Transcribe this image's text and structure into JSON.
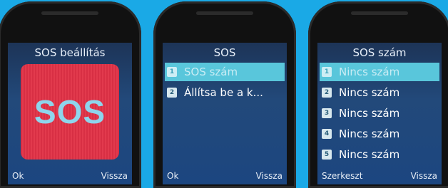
{
  "phone1": {
    "title": "SOS beállítás",
    "tile_text": "SOS",
    "softkey_left": "Ok",
    "softkey_right": "Vissza"
  },
  "phone2": {
    "title": "SOS",
    "items": [
      {
        "num": "1",
        "label": "SOS szám"
      },
      {
        "num": "2",
        "label": "Állítsa be a k..."
      }
    ],
    "softkey_left": "Ok",
    "softkey_right": "Vissza"
  },
  "phone3": {
    "title": "SOS szám",
    "items": [
      {
        "num": "1",
        "label": "Nincs szám"
      },
      {
        "num": "2",
        "label": "Nincs szám"
      },
      {
        "num": "3",
        "label": "Nincs szám"
      },
      {
        "num": "4",
        "label": "Nincs szám"
      },
      {
        "num": "5",
        "label": "Nincs szám"
      }
    ],
    "softkey_left": "Szerkeszt",
    "softkey_right": "Vissza"
  },
  "colors": {
    "background": "#1aa9e6",
    "sos_tile": "#e23a4d",
    "selection": "#59c6db"
  }
}
